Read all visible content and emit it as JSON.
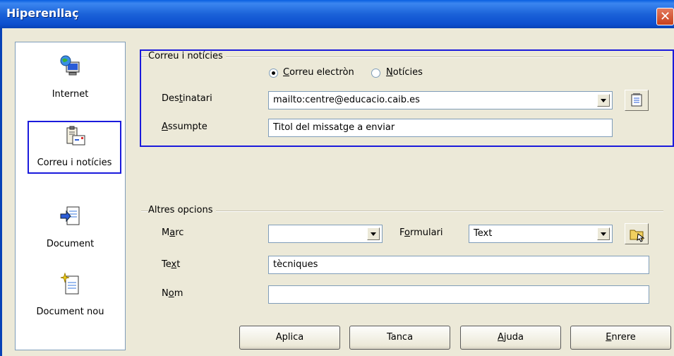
{
  "window": {
    "title": "Hiperenllaç",
    "close_icon": "close-icon"
  },
  "sidebar": {
    "items": [
      {
        "label": "Internet",
        "icon": "globe-computer-icon"
      },
      {
        "label": "Correu i notícies",
        "icon": "mail-clipboard-icon",
        "selected": true
      },
      {
        "label": "Document",
        "icon": "document-arrow-icon"
      },
      {
        "label": "Document nou",
        "icon": "new-document-icon"
      }
    ]
  },
  "mail": {
    "group_label": "Correu i notícies",
    "radio_mail": {
      "pre": "",
      "u": "C",
      "post": "orreu electròn",
      "checked": true
    },
    "radio_news": {
      "pre": "",
      "u": "N",
      "post": "otícies",
      "checked": false
    },
    "recipient_label": {
      "pre": "Des",
      "u": "t",
      "post": "inatari"
    },
    "recipient_value": "mailto:centre@educacio.caib.es",
    "subject_label": {
      "pre": "",
      "u": "A",
      "post": "ssumpte"
    },
    "subject_value": "Titol del missatge a enviar",
    "address_book_icon": "address-book-icon"
  },
  "options": {
    "group_label": "Altres opcions",
    "frame_label": {
      "pre": "M",
      "u": "a",
      "post": "rc"
    },
    "frame_value": "",
    "form_label": {
      "pre": "F",
      "u": "o",
      "post": "rmulari"
    },
    "form_value": "Text",
    "text_label": {
      "pre": "Te",
      "u": "x",
      "post": "t"
    },
    "text_value": "tècniques",
    "name_label": {
      "pre": "N",
      "u": "o",
      "post": "m"
    },
    "name_value": "",
    "event_icon": "event-folder-icon"
  },
  "buttons": {
    "apply": {
      "pre": "Aplica",
      "u": "",
      "post": ""
    },
    "close": {
      "pre": "Tanca",
      "u": "",
      "post": ""
    },
    "help": {
      "pre": "",
      "u": "A",
      "post": "juda"
    },
    "back": {
      "pre": "",
      "u": "E",
      "post": "nrere"
    }
  },
  "colors": {
    "titlebar": "#0a5fe0",
    "highlight_box": "#1a1adc",
    "dialog_bg": "#ece9d8"
  }
}
